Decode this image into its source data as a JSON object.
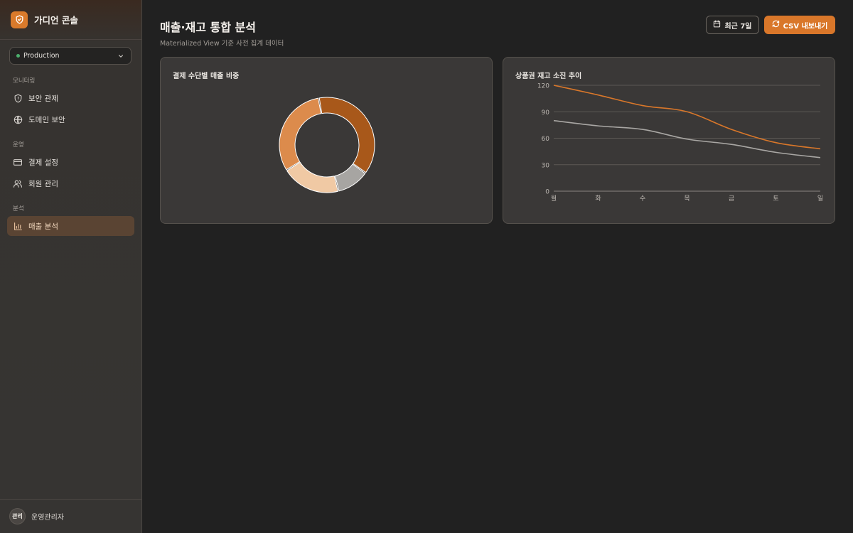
{
  "brand": {
    "name": "가디언 콘솔",
    "accent": "#d97a2b"
  },
  "environment": {
    "selected": "Production",
    "status_color": "#4caf6d"
  },
  "sidebar": {
    "sections": [
      {
        "label": "모니터링",
        "items": [
          {
            "label": "보안 관제",
            "icon": "shield-icon"
          },
          {
            "label": "도메인 보안",
            "icon": "globe-icon"
          }
        ]
      },
      {
        "label": "운영",
        "items": [
          {
            "label": "결제 설정",
            "icon": "credit-card-icon"
          },
          {
            "label": "회원 관리",
            "icon": "users-icon"
          }
        ]
      },
      {
        "label": "분석",
        "items": [
          {
            "label": "매출 분석",
            "icon": "bar-chart-icon",
            "active": true
          }
        ]
      }
    ]
  },
  "user": {
    "avatar_text": "관리",
    "name": "운영관리자"
  },
  "header": {
    "title": "매출·재고 통합 분석",
    "subtitle": "Materialized View 기준 사전 집계 데이터",
    "range_label": "최근 7일",
    "export_label": "CSV 내보내기"
  },
  "chart_data": [
    {
      "type": "pie",
      "title": "결제 수단별 매출 비중",
      "values": [
        34,
        10,
        18,
        28
      ],
      "colors": [
        "#a8581a",
        "#a7a5a2",
        "#f0c9a4",
        "#dc8b4c"
      ]
    },
    {
      "type": "line",
      "title": "상품권 재고 소진 추이",
      "categories": [
        "월",
        "화",
        "수",
        "목",
        "금",
        "토",
        "일"
      ],
      "series": [
        {
          "values": [
            120,
            109,
            97,
            90,
            70,
            55,
            48
          ],
          "color": "#d9772a"
        },
        {
          "values": [
            80,
            74,
            70,
            59,
            53,
            44,
            38
          ],
          "color": "#a9a7a4"
        }
      ],
      "yticks": [
        0,
        30,
        60,
        90,
        120
      ],
      "ylim": [
        0,
        120
      ],
      "grid": true
    }
  ]
}
